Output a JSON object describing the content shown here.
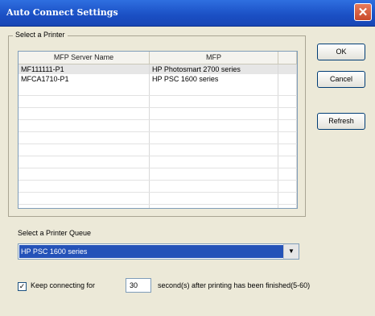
{
  "window": {
    "title": "Auto Connect Settings",
    "close_glyph": "✕"
  },
  "printer_group": {
    "label": "Select a Printer",
    "columns": [
      "MFP Server Name",
      "MFP",
      ""
    ],
    "rows": [
      {
        "server": "MF111111-P1",
        "mfp": "HP Photosmart 2700 series"
      },
      {
        "server": "MFCA1710-P1",
        "mfp": "HP PSC 1600 series"
      }
    ]
  },
  "buttons": {
    "ok": "OK",
    "cancel": "Cancel",
    "refresh": "Refresh"
  },
  "queue": {
    "label": "Select a Printer Queue",
    "selected": "HP PSC 1600 series",
    "arrow_glyph": "▼"
  },
  "keep_connecting": {
    "checked_glyph": "✓",
    "label": "Keep connecting for",
    "seconds_value": "30",
    "suffix": "second(s) after printing has been finished(5-60)"
  }
}
